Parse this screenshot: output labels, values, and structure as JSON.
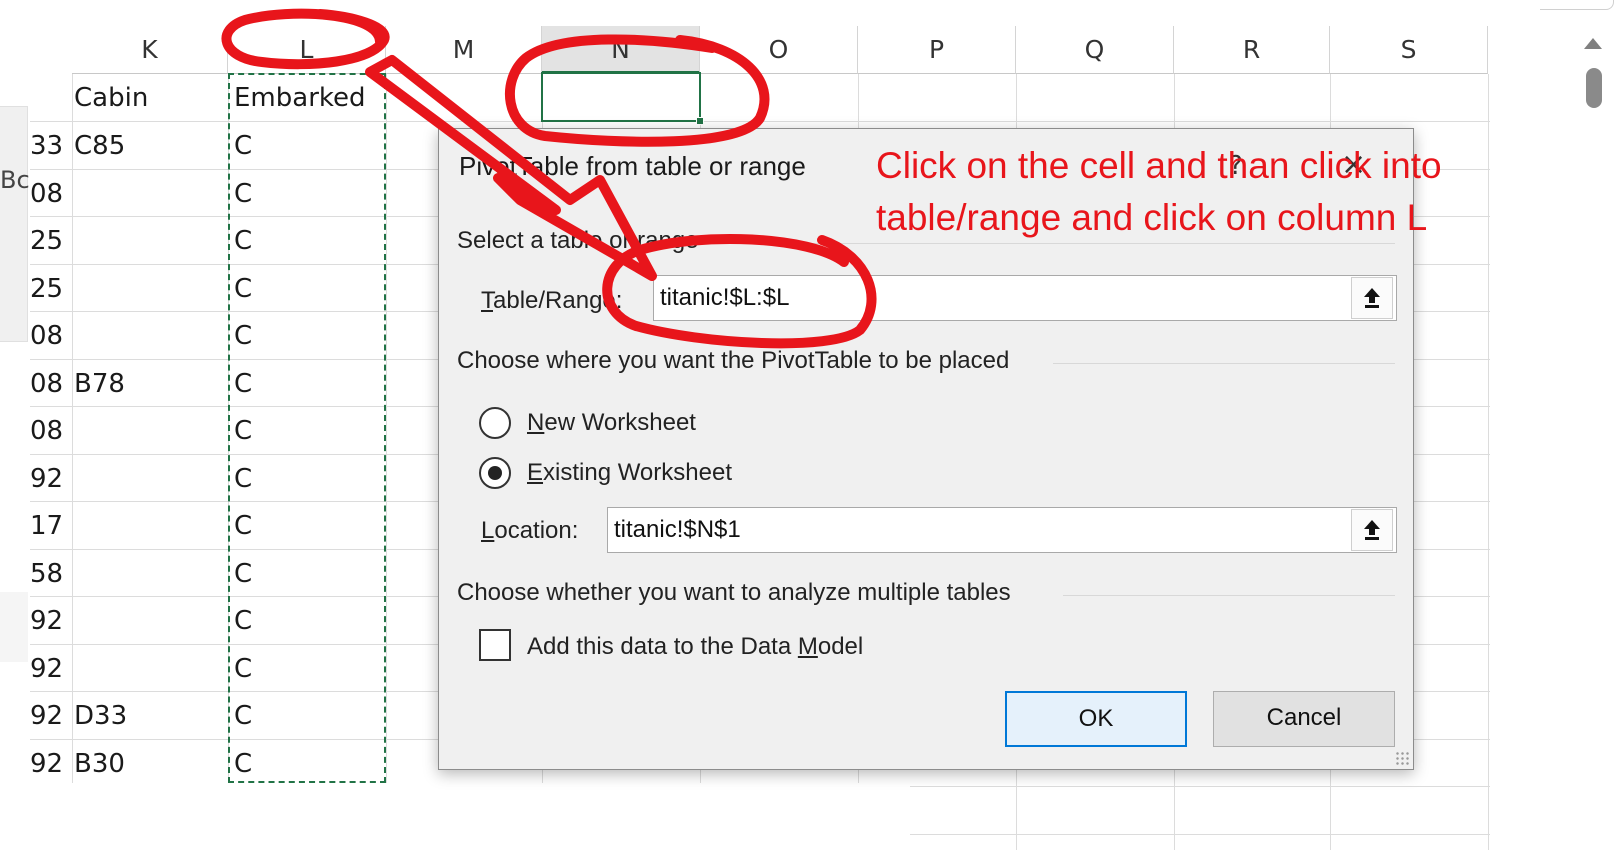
{
  "sheet": {
    "columns": [
      "K",
      "L",
      "M",
      "N",
      "O",
      "P",
      "Q",
      "R",
      "S"
    ],
    "selected_column": "N",
    "header_row": {
      "k": "Cabin",
      "l": "Embarked"
    },
    "left_panel_text": "Bc",
    "rows": [
      {
        "j": "33",
        "k": "C85",
        "l": "C"
      },
      {
        "j": "08",
        "k": "",
        "l": "C"
      },
      {
        "j": "25",
        "k": "",
        "l": "C"
      },
      {
        "j": "25",
        "k": "",
        "l": "C"
      },
      {
        "j": "08",
        "k": "",
        "l": "C"
      },
      {
        "j": "08",
        "k": "B78",
        "l": "C"
      },
      {
        "j": "08",
        "k": "",
        "l": "C"
      },
      {
        "j": "92",
        "k": "",
        "l": "C"
      },
      {
        "j": "17",
        "k": "",
        "l": "C"
      },
      {
        "j": "58",
        "k": "",
        "l": "C"
      },
      {
        "j": "92",
        "k": "",
        "l": "C"
      },
      {
        "j": "92",
        "k": "",
        "l": "C"
      },
      {
        "j": "92",
        "k": "D33",
        "l": "C"
      },
      {
        "j": "92",
        "k": "B30",
        "l": "C"
      }
    ]
  },
  "dialog": {
    "title": "PivotTable from table or range",
    "help_icon": "?",
    "close_icon": "×",
    "section_select": "Select a table or range",
    "table_range_label": "Table/Range:",
    "table_range_value": "titanic!$L:$L",
    "section_place": "Choose where you want the PivotTable to be placed",
    "option_new": "New Worksheet",
    "option_existing": "Existing Worksheet",
    "selected_option": "existing",
    "location_label": "Location:",
    "location_value": "titanic!$N$1",
    "section_multiple": "Choose whether you want to analyze multiple tables",
    "data_model_label": "Add this data to the Data Model",
    "data_model_checked": false,
    "ok_label": "OK",
    "cancel_label": "Cancel"
  },
  "annotation": {
    "line1": "Click on the cell and than click into",
    "line2": "table/range and click on column L",
    "color": "#e8151b"
  },
  "colors": {
    "excel_green": "#217346",
    "dialog_bg": "#f0f0f0",
    "ok_border": "#0078d7"
  }
}
